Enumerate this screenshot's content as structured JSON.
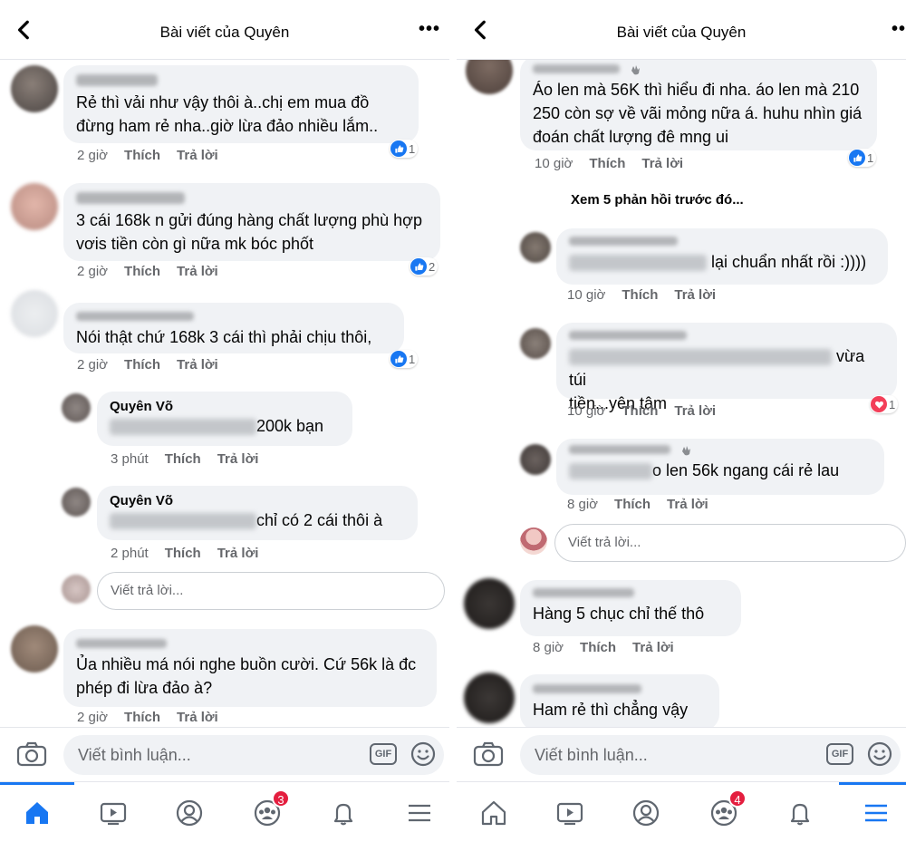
{
  "left": {
    "header": {
      "title": "Bài viết của Quyên"
    },
    "comments": [
      {
        "text": "Rẻ thì vải như vậy thôi à..chị em mua đồ đừng ham rẻ nha..giờ lừa đảo nhiều lắm..",
        "time": "2 giờ",
        "like": "Thích",
        "reply": "Trả lời",
        "reactions": "1",
        "reaction_type": "like"
      },
      {
        "text": "3 cái 168k n gửi đúng hàng  chất lượng phù hợp vơis tiền còn gì nữa mk bóc phốt",
        "time": "2 giờ",
        "like": "Thích",
        "reply": "Trả lời",
        "reactions": "2",
        "reaction_type": "like"
      },
      {
        "text": "Nói thật chứ 168k 3 cái thì phải chịu thôi,",
        "time": "2 giờ",
        "like": "Thích",
        "reply": "Trả lời",
        "reactions": "1",
        "reaction_type": "like"
      },
      {
        "name": "Quyên Võ",
        "text": "200k bạn",
        "time": "3 phút",
        "like": "Thích",
        "reply": "Trả lời"
      },
      {
        "name": "Quyên Võ",
        "text": "chỉ có 2 cái thôi à",
        "time": "2 phút",
        "like": "Thích",
        "reply": "Trả lời"
      },
      {
        "text": "Ủa nhiều má nói nghe buồn cười. Cứ 56k là đc phép đi lừa đảo à?",
        "time": "2 giờ",
        "like": "Thích",
        "reply": "Trả lời"
      }
    ],
    "reply_placeholder": "Viết trả lời...",
    "composer": {
      "placeholder": "Viết bình luận...",
      "gif": "GIF"
    },
    "tabs": {
      "groups_badge": "3"
    }
  },
  "right": {
    "header": {
      "title": "Bài viết của Quyên"
    },
    "comments": [
      {
        "text": "Áo len mà 56K thì hiểu đi nha.  áo len mà 210 250 còn sợ về vãi mỏng nữa á.  huhu nhìn giá đoán chất lượng đê mng ui",
        "time": "10 giờ",
        "like": "Thích",
        "reply": "Trả lời",
        "reactions": "1",
        "reaction_type": "like"
      },
      {
        "text": "lại chuẩn nhất rồi :))))",
        "time": "10 giờ",
        "like": "Thích",
        "reply": "Trả lời"
      },
      {
        "text_a": "vừa túi",
        "text_b": "tiền...yên tâm",
        "time": "10 giờ",
        "like": "Thích",
        "reply": "Trả lời",
        "reactions": "1",
        "reaction_type": "love"
      },
      {
        "text": "o len 56k ngang cái rẻ lau",
        "time": "8 giờ",
        "like": "Thích",
        "reply": "Trả lời"
      },
      {
        "text": "Hàng 5 chục chỉ thế thô",
        "time": "8 giờ",
        "like": "Thích",
        "reply": "Trả lời"
      },
      {
        "text": "Ham rẻ thì chẳng vậy"
      }
    ],
    "previous_replies": "Xem 5 phản hồi trước đó...",
    "reply_placeholder": "Viết trả lời...",
    "composer": {
      "placeholder": "Viết bình luận...",
      "gif": "GIF"
    },
    "tabs": {
      "groups_badge": "4"
    }
  },
  "colors": {
    "accent": "#1877f2",
    "bubble": "#f0f2f5",
    "badge": "#e41e3f",
    "love": "#f33e58"
  },
  "icons": [
    "back-arrow-icon",
    "more-icon",
    "camera-icon",
    "gif-icon",
    "emoji-icon",
    "home-icon",
    "watch-icon",
    "profile-icon",
    "groups-icon",
    "bell-icon",
    "menu-icon",
    "like-icon",
    "love-icon",
    "wave-hand-icon"
  ]
}
